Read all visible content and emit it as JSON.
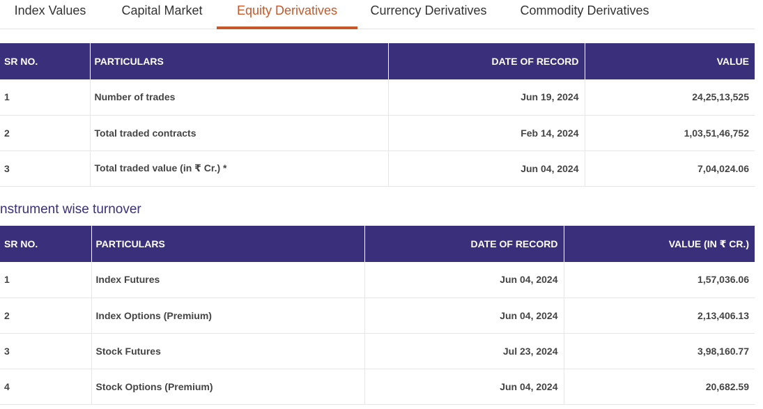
{
  "tabs": [
    {
      "label": "Index Values"
    },
    {
      "label": "Capital Market"
    },
    {
      "label": "Equity Derivatives",
      "active": true
    },
    {
      "label": "Currency Derivatives"
    },
    {
      "label": "Commodity Derivatives"
    }
  ],
  "table1": {
    "headers": [
      "SR NO.",
      "PARTICULARS",
      "DATE OF RECORD",
      "VALUE"
    ],
    "rows": [
      [
        "1",
        "Number of trades",
        "Jun 19, 2024",
        "24,25,13,525"
      ],
      [
        "2",
        "Total traded contracts",
        "Feb 14, 2024",
        "1,03,51,46,752"
      ],
      [
        "3",
        "Total traded value (in ₹ Cr.) *",
        "Jun 04, 2024",
        "7,04,024.06"
      ]
    ]
  },
  "section": {
    "title": "nstrument wise turnover"
  },
  "table2": {
    "headers": [
      "SR NO.",
      "PARTICULARS",
      "DATE OF RECORD",
      "VALUE (IN ₹ CR.)"
    ],
    "rows": [
      [
        "1",
        "Index Futures",
        "Jun 04, 2024",
        "1,57,036.06"
      ],
      [
        "2",
        "Index Options (Premium)",
        "Jun 04, 2024",
        "2,13,406.13"
      ],
      [
        "3",
        "Stock Futures",
        "Jul 23, 2024",
        "3,98,160.77"
      ],
      [
        "4",
        "Stock Options (Premium)",
        "Jun 04, 2024",
        "20,682.59"
      ]
    ]
  },
  "colors": {
    "accent": "#c8582a",
    "header_bg": "#3a2f7a"
  }
}
